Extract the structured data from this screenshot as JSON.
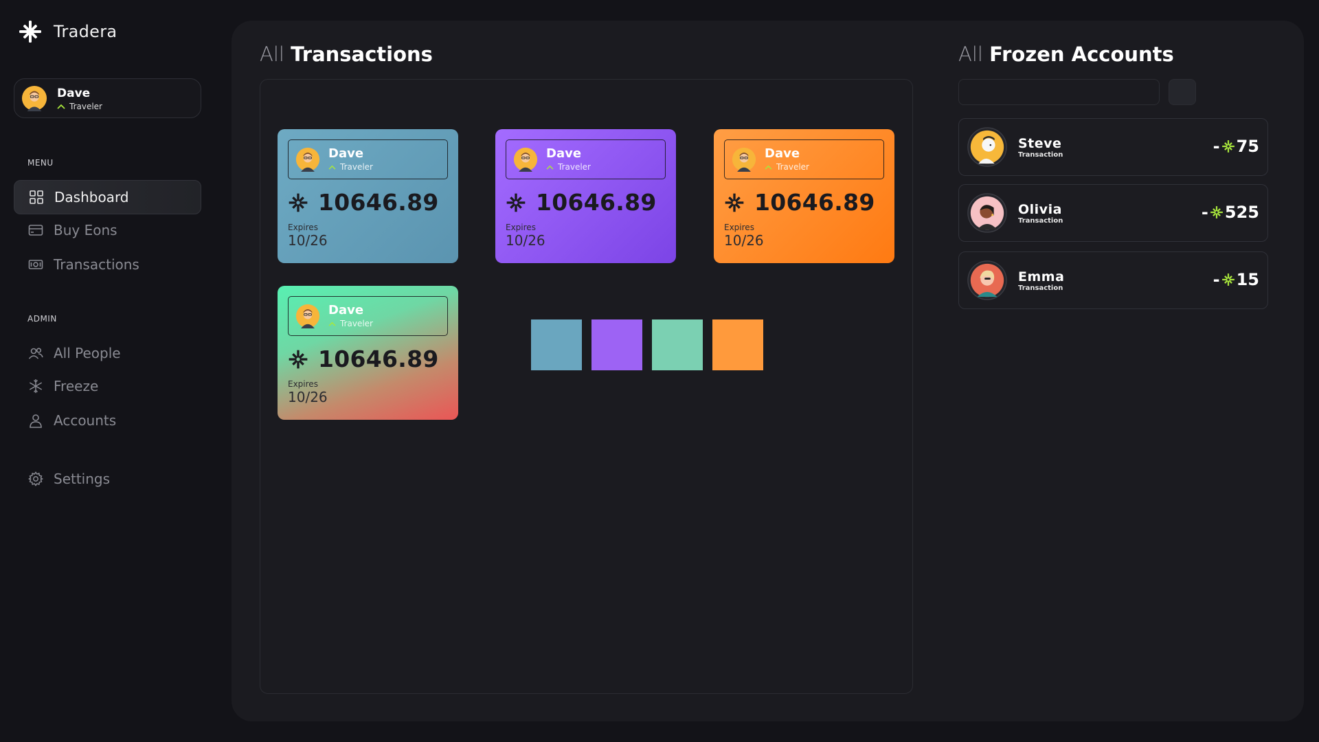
{
  "app": {
    "name": "Tradera"
  },
  "profile": {
    "name": "Dave",
    "role": "Traveler"
  },
  "menu": {
    "label": "MENU",
    "items": [
      {
        "label": "Dashboard",
        "icon": "grid-icon",
        "active": true
      },
      {
        "label": "Buy Eons",
        "icon": "card-icon"
      },
      {
        "label": "Transactions",
        "icon": "cash-icon"
      }
    ]
  },
  "admin": {
    "label": "ADMIN",
    "items": [
      {
        "label": "All People",
        "icon": "people-icon"
      },
      {
        "label": "Freeze",
        "icon": "snowflake-icon"
      },
      {
        "label": "Accounts",
        "icon": "user-icon"
      }
    ]
  },
  "settings": {
    "label": "Settings",
    "icon": "gear-icon"
  },
  "transactions": {
    "title_prefix": "All",
    "title_bold": "Transactions",
    "cards": [
      {
        "name": "Dave",
        "role": "Traveler",
        "amount": "10646.89",
        "expires_label": "Expires",
        "expires": "10/26",
        "color": "#5b94b0"
      },
      {
        "name": "Dave",
        "role": "Traveler",
        "amount": "10646.89",
        "expires_label": "Expires",
        "expires": "10/26",
        "color": "#8f57f2"
      },
      {
        "name": "Dave",
        "role": "Traveler",
        "amount": "10646.89",
        "expires_label": "Expires",
        "expires": "10/26",
        "color": "#ff8a2a"
      },
      {
        "name": "Dave",
        "role": "Traveler",
        "amount": "10646.89",
        "expires_label": "Expires",
        "expires": "10/26",
        "color": "#58f0b2"
      }
    ],
    "swatches": [
      "#6aa6bf",
      "#9d63f4",
      "#7bd0b2",
      "#ff9a3c"
    ]
  },
  "frozen": {
    "title_prefix": "All",
    "title_bold": "Frozen Accounts",
    "search": {
      "value": "",
      "placeholder": ""
    },
    "rows": [
      {
        "name": "Steve",
        "sub": "Transaction",
        "sign": "-",
        "amount": "75"
      },
      {
        "name": "Olivia",
        "sub": "Transaction",
        "sign": "-",
        "amount": "525"
      },
      {
        "name": "Emma",
        "sub": "Transaction",
        "sign": "-",
        "amount": "15"
      }
    ]
  },
  "colors": {
    "accent_green": "#a8e63c",
    "background": "#131318",
    "panel": "#1b1b20"
  }
}
